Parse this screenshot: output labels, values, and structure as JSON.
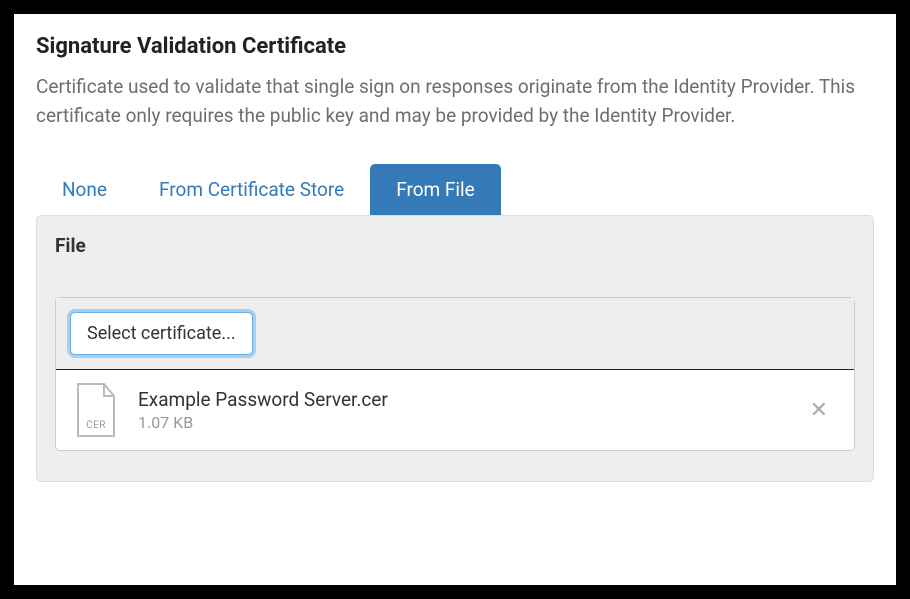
{
  "title": "Signature Validation Certificate",
  "description": "Certificate used to validate that single sign on responses originate from the Identity Provider. This certificate only requires the public key and may be provided by the Identity Provider.",
  "tabs": {
    "none": "None",
    "store": "From Certificate Store",
    "file": "From File"
  },
  "section": {
    "label": "File",
    "select_label": "Select certificate..."
  },
  "file": {
    "name": "Example Password Server.cer",
    "size": "1.07 KB",
    "ext": "CER"
  }
}
